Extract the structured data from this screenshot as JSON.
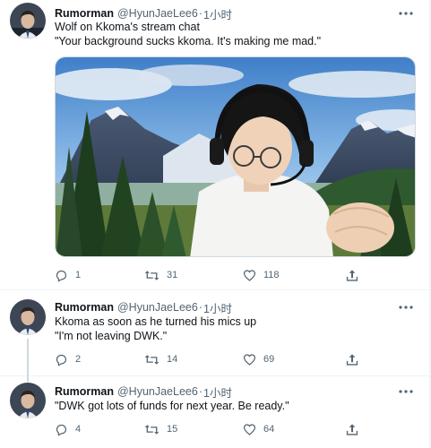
{
  "tweets": [
    {
      "name": "Rumorman",
      "handle": "@HyunJaeLee6",
      "separator": "·",
      "time": "1小时",
      "lines": [
        "Wolf on Kkoma's stream chat",
        "\"Your background sucks kkoma. It's making me mad.\""
      ],
      "replies": "1",
      "retweets": "31",
      "likes": "118",
      "has_media": true
    },
    {
      "name": "Rumorman",
      "handle": "@HyunJaeLee6",
      "separator": "·",
      "time": "1小时",
      "lines": [
        "Kkoma as soon as he turned his mics up",
        "\"I'm not leaving DWK.\""
      ],
      "replies": "2",
      "retweets": "14",
      "likes": "69"
    },
    {
      "name": "Rumorman",
      "handle": "@HyunJaeLee6",
      "separator": "·",
      "time": "1小时",
      "lines": [
        "\"DWK got lots of funds for next year. Be ready.\""
      ],
      "replies": "4",
      "retweets": "15",
      "likes": "64"
    }
  ],
  "icons": {
    "reply": "reply-icon",
    "retweet": "retweet-icon",
    "like": "heart-icon",
    "share": "share-icon",
    "more": "more-icon"
  },
  "colors": {
    "text_primary": "#0f1419",
    "text_secondary": "#536471",
    "divider": "#eff3f4",
    "thread_line": "#cfd9de"
  }
}
